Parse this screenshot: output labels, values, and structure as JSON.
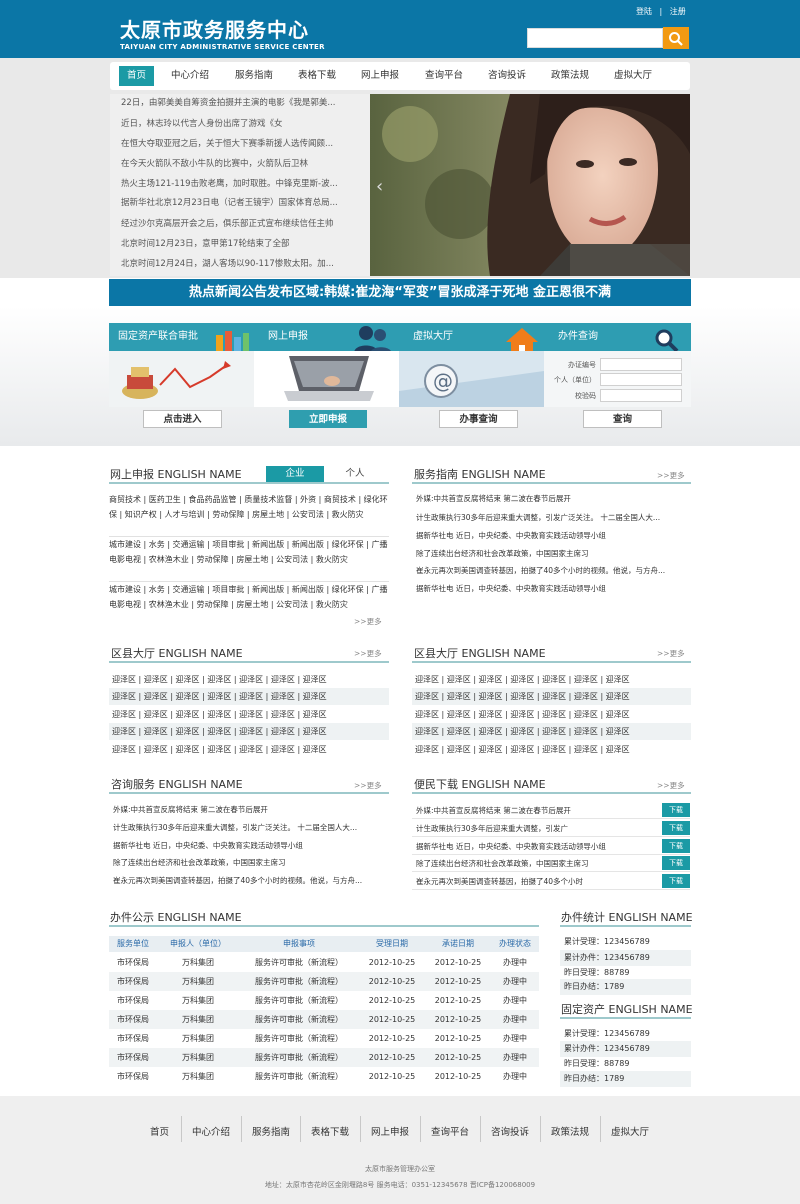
{
  "header": {
    "title_cn": "太原市政务服务中心",
    "title_en": "TAIYUAN CITY ADMINISTRATIVE SERVICE CENTER",
    "login": "登陆",
    "sep": "|",
    "register": "注册",
    "search_placeholder": "",
    "search_icon": "search-icon"
  },
  "nav": [
    "首页",
    "中心介绍",
    "服务指南",
    "表格下载",
    "网上申报",
    "查询平台",
    "咨询投诉",
    "政策法规",
    "虚拟大厅"
  ],
  "news": [
    "22日，由郭美美自筹资金拍摄并主演的电影《我是郭美...",
    "近日，林志玲以代言人身份出席了游戏《女",
    "在恒大夺取亚冠之后，关于恒大下赛季新援人选传闻颇...",
    "在今天火箭队不敌小牛队的比赛中，火箭队后卫林",
    "热火主场121-119击败老鹰，加时取胜。中锋克里斯-波...",
    "据新华社北京12月23日电（记者王镜宇）国家体育总局...",
    "经过沙尔克高层开会之后，俱乐部正式宣布继续信任主帅",
    "北京时间12月23日，意甲第17轮结束了全部",
    "北京时间12月24日，湖人客场以90-117惨败太阳。加..."
  ],
  "hotbar": "热点新闻公告发布区域:韩媒:崔龙海“军变”冒张成泽于死地 金正恩很不满",
  "services": {
    "s1": {
      "title": "固定资产联合审批",
      "button": "点击进入"
    },
    "s2": {
      "title": "网上申报",
      "button": "立即申报"
    },
    "s3": {
      "title": "虚拟大厅",
      "button": "办事查询"
    },
    "s4": {
      "title": "办件查询",
      "button": "查询",
      "label1": "办证编号",
      "label2": "个人（单位）",
      "label3": "校验码"
    }
  },
  "online": {
    "title": "网上申报 ENGLISH NAME",
    "tab1": "企业",
    "tab2": "个人",
    "group1": "商贸技术 | 医药卫生 | 食品药品监管 | 质量技术监督 | 外资 | 商贸技术 | 绿化环保 | 知识产权 | 人才与培训 | 劳动保障 | 房屋土地 | 公安司法 | 救火防灾",
    "group2": "城市建设 | 水务 | 交通运输 | 项目审批 | 新闻出版 | 新闻出版 | 绿化环保 | 广播电影电视 | 农林渔木业 | 劳动保障 | 房屋土地 | 公安司法 | 救火防灾",
    "group3": "城市建设 | 水务 | 交通运输 | 项目审批 | 新闻出版 | 新闻出版 | 绿化环保 | 广播电影电视 | 农林渔木业 | 劳动保障 | 房屋土地 | 公安司法 | 救火防灾",
    "more": ">>更多"
  },
  "guide": {
    "title": "服务指南 ENGLISH NAME",
    "more": ">>更多",
    "items": [
      "外媒:中共首宣反腐将结束 第二波在春节后展开",
      "计生政策执行30多年后迎来重大调整，引发广泛关注。 十二届全国人大...",
      "据新华社电 近日，中央纪委、中央教育实践活动领导小组",
      "除了连续出台经济和社会改革政策，中国国家主席习",
      "崔永元再次到美国调查转基因，拍摄了40多个小时的视频。他说，与方舟...",
      "据新华社电 近日，中央纪委、中央教育实践活动领导小组"
    ]
  },
  "district1": {
    "title": "区县大厅 ENGLISH NAME",
    "more": ">>更多",
    "rows": [
      "迎泽区 | 迎泽区 | 迎泽区 | 迎泽区 | 迎泽区 | 迎泽区 | 迎泽区",
      "迎泽区 | 迎泽区 | 迎泽区 | 迎泽区 | 迎泽区 | 迎泽区 | 迎泽区",
      "迎泽区 | 迎泽区 | 迎泽区 | 迎泽区 | 迎泽区 | 迎泽区 | 迎泽区",
      "迎泽区 | 迎泽区 | 迎泽区 | 迎泽区 | 迎泽区 | 迎泽区 | 迎泽区",
      "迎泽区 | 迎泽区 | 迎泽区 | 迎泽区 | 迎泽区 | 迎泽区 | 迎泽区"
    ]
  },
  "district2": {
    "title": "区县大厅 ENGLISH NAME",
    "more": ">>更多",
    "rows": [
      "迎泽区 | 迎泽区 | 迎泽区 | 迎泽区 | 迎泽区 | 迎泽区 | 迎泽区",
      "迎泽区 | 迎泽区 | 迎泽区 | 迎泽区 | 迎泽区 | 迎泽区 | 迎泽区",
      "迎泽区 | 迎泽区 | 迎泽区 | 迎泽区 | 迎泽区 | 迎泽区 | 迎泽区",
      "迎泽区 | 迎泽区 | 迎泽区 | 迎泽区 | 迎泽区 | 迎泽区 | 迎泽区",
      "迎泽区 | 迎泽区 | 迎泽区 | 迎泽区 | 迎泽区 | 迎泽区 | 迎泽区"
    ]
  },
  "consult": {
    "title": "咨询服务 ENGLISH NAME",
    "more": ">>更多",
    "items": [
      "外媒:中共首宣反腐将结束 第二波在春节后展开",
      "计生政策执行30多年后迎来重大调整，引发广泛关注。 十二届全国人大...",
      "据新华社电 近日，中央纪委、中央教育实践活动领导小组",
      "除了连续出台经济和社会改革政策，中国国家主席习",
      "崔永元再次到美国调查转基因，拍摄了40多个小时的视频。他说，与方舟..."
    ]
  },
  "download": {
    "title": "便民下载 ENGLISH NAME",
    "more": ">>更多",
    "button": "下载",
    "items": [
      "外媒:中共首宣反腐将结束 第二波在春节后展开",
      "计生政策执行30多年后迎来重大调整，引发广",
      "据新华社电 近日，中央纪委、中央教育实践活动领导小组",
      "除了连续出台经济和社会改革政策，中国国家主席习",
      "崔永元再次到美国调查转基因，拍摄了40多个小时"
    ]
  },
  "publicity": {
    "title": "办件公示 ENGLISH NAME",
    "headers": [
      "服务单位",
      "申报人（单位）",
      "申报事项",
      "受理日期",
      "承诺日期",
      "办理状态"
    ],
    "rows": [
      [
        "市环保局",
        "万科集团",
        "服务许可审批（新流程）",
        "2012-10-25",
        "2012-10-25",
        "办理中"
      ],
      [
        "市环保局",
        "万科集团",
        "服务许可审批（新流程）",
        "2012-10-25",
        "2012-10-25",
        "办理中"
      ],
      [
        "市环保局",
        "万科集团",
        "服务许可审批（新流程）",
        "2012-10-25",
        "2012-10-25",
        "办理中"
      ],
      [
        "市环保局",
        "万科集团",
        "服务许可审批（新流程）",
        "2012-10-25",
        "2012-10-25",
        "办理中"
      ],
      [
        "市环保局",
        "万科集团",
        "服务许可审批（新流程）",
        "2012-10-25",
        "2012-10-25",
        "办理中"
      ],
      [
        "市环保局",
        "万科集团",
        "服务许可审批（新流程）",
        "2012-10-25",
        "2012-10-25",
        "办理中"
      ],
      [
        "市环保局",
        "万科集团",
        "服务许可审批（新流程）",
        "2012-10-25",
        "2012-10-25",
        "办理中"
      ]
    ]
  },
  "stats": {
    "title": "办件统计 ENGLISH NAME",
    "items": [
      "累计受理：123456789",
      "累计办件：123456789",
      "昨日受理：88789",
      "昨日办结：1789"
    ]
  },
  "assets": {
    "title": "固定资产 ENGLISH NAME",
    "items": [
      "累计受理：123456789",
      "累计办件：123456789",
      "昨日受理：88789",
      "昨日办结：1789"
    ]
  },
  "footer": {
    "nav": [
      "首页",
      "中心介绍",
      "服务指南",
      "表格下载",
      "网上申报",
      "查询平台",
      "咨询投诉",
      "政策法规",
      "虚拟大厅"
    ],
    "org": "太原市服务管理办公室",
    "address": "地址：太原市杏花岭区金刚堰路8号 服务电话：0351-12345678 晋ICP备120068009"
  },
  "colors": {
    "brand": "#0b76a6",
    "accent": "#1b9aa5",
    "search": "#f29a12"
  }
}
